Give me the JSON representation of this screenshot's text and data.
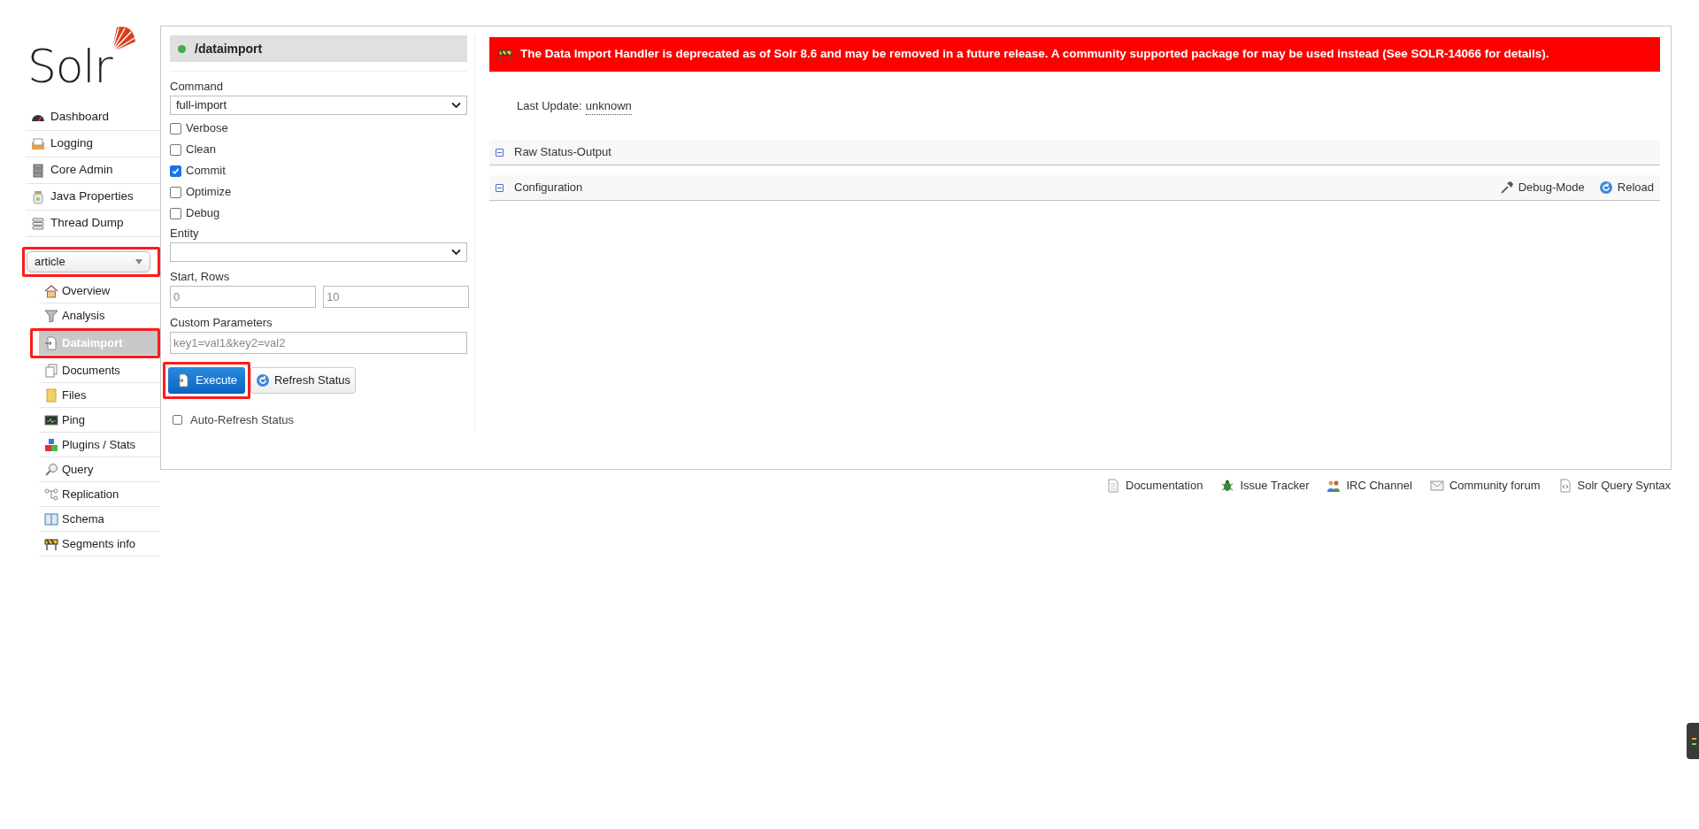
{
  "logo": {
    "text": "Solr"
  },
  "nav": [
    {
      "label": "Dashboard"
    },
    {
      "label": "Logging"
    },
    {
      "label": "Core Admin"
    },
    {
      "label": "Java Properties"
    },
    {
      "label": "Thread Dump"
    }
  ],
  "core_selector": {
    "value": "article",
    "highlighted": true
  },
  "core_menu": [
    {
      "label": "Overview",
      "selected": false,
      "highlighted": false
    },
    {
      "label": "Analysis",
      "selected": false,
      "highlighted": false
    },
    {
      "label": "Dataimport",
      "selected": true,
      "highlighted": true
    },
    {
      "label": "Documents",
      "selected": false,
      "highlighted": false
    },
    {
      "label": "Files",
      "selected": false,
      "highlighted": false
    },
    {
      "label": "Ping",
      "selected": false,
      "highlighted": false
    },
    {
      "label": "Plugins / Stats",
      "selected": false,
      "highlighted": false
    },
    {
      "label": "Query",
      "selected": false,
      "highlighted": false
    },
    {
      "label": "Replication",
      "selected": false,
      "highlighted": false
    },
    {
      "label": "Schema",
      "selected": false,
      "highlighted": false
    },
    {
      "label": "Segments info",
      "selected": false,
      "highlighted": false
    }
  ],
  "handler": {
    "name": "/dataimport"
  },
  "form": {
    "command_label": "Command",
    "command_value": "full-import",
    "options": [
      {
        "label": "Verbose",
        "checked": false
      },
      {
        "label": "Clean",
        "checked": false
      },
      {
        "label": "Commit",
        "checked": true
      },
      {
        "label": "Optimize",
        "checked": false
      },
      {
        "label": "Debug",
        "checked": false
      }
    ],
    "entity_label": "Entity",
    "start_rows_label": "Start, Rows",
    "start_value": "0",
    "rows_value": "10",
    "custom_label": "Custom Parameters",
    "custom_placeholder": "key1=val1&key2=val2",
    "execute": {
      "label": "Execute",
      "highlighted": true
    },
    "refresh": "Refresh Status",
    "auto_refresh": {
      "label": "Auto-Refresh Status",
      "checked": false
    }
  },
  "banner": "The Data Import Handler is deprecated as of Solr 8.6 and may be removed in a future release. A community supported package for may be used instead (See SOLR-14066 for details).",
  "last_update": {
    "label": "Last Update:",
    "value": "unknown"
  },
  "sections": [
    {
      "title": "Raw Status-Output",
      "expanded": true
    },
    {
      "title": "Configuration",
      "expanded": true,
      "actions": [
        {
          "label": "Debug-Mode"
        },
        {
          "label": "Reload"
        }
      ]
    }
  ],
  "footer": [
    {
      "label": "Documentation"
    },
    {
      "label": "Issue Tracker"
    },
    {
      "label": "IRC Channel"
    },
    {
      "label": "Community forum"
    },
    {
      "label": "Solr Query Syntax"
    }
  ]
}
